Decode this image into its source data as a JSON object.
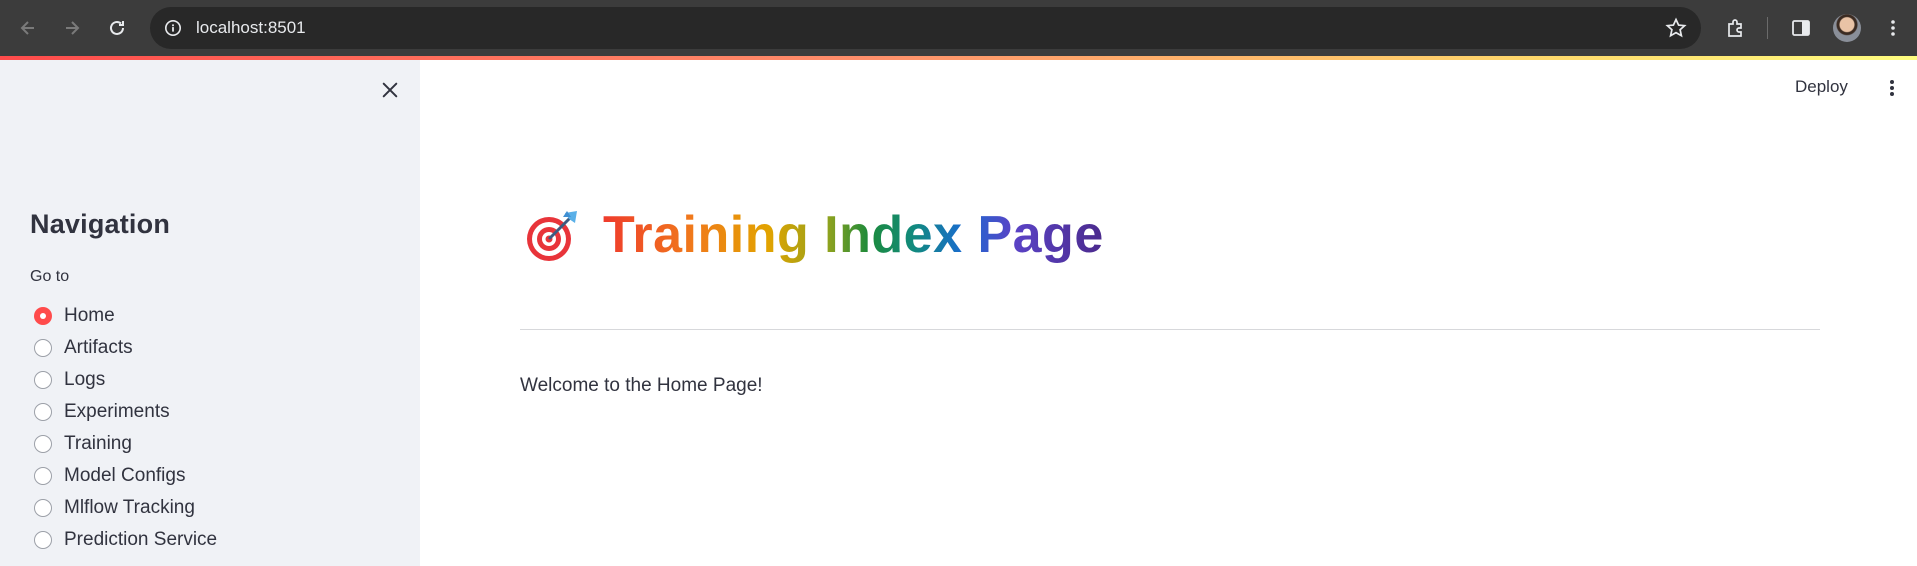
{
  "browser": {
    "url": "localhost:8501",
    "icons": [
      "back-icon",
      "forward-icon",
      "reload-icon",
      "site-info-icon",
      "bookmark-star-icon",
      "extensions-icon",
      "side-panel-icon",
      "profile-avatar",
      "menu-icon"
    ]
  },
  "sidebar": {
    "close_icon": "close-icon",
    "title": "Navigation",
    "radio_label": "Go to",
    "options": [
      {
        "label": "Home",
        "selected": true
      },
      {
        "label": "Artifacts",
        "selected": false
      },
      {
        "label": "Logs",
        "selected": false
      },
      {
        "label": "Experiments",
        "selected": false
      },
      {
        "label": "Training",
        "selected": false
      },
      {
        "label": "Model Configs",
        "selected": false
      },
      {
        "label": "Mlflow Tracking",
        "selected": false
      },
      {
        "label": "Prediction Service",
        "selected": false
      }
    ]
  },
  "header": {
    "deploy_label": "Deploy",
    "menu_icon": "kebab-menu-icon"
  },
  "main": {
    "title_icon": "direct-hit-icon",
    "title": "Training Index Page",
    "welcome_text": "Welcome to the Home Page!"
  },
  "colors": {
    "accent": "#ff4b4b",
    "sidebar_bg": "#f0f2f6",
    "text": "#31333f",
    "chrome_bg": "#3c3c3c"
  }
}
